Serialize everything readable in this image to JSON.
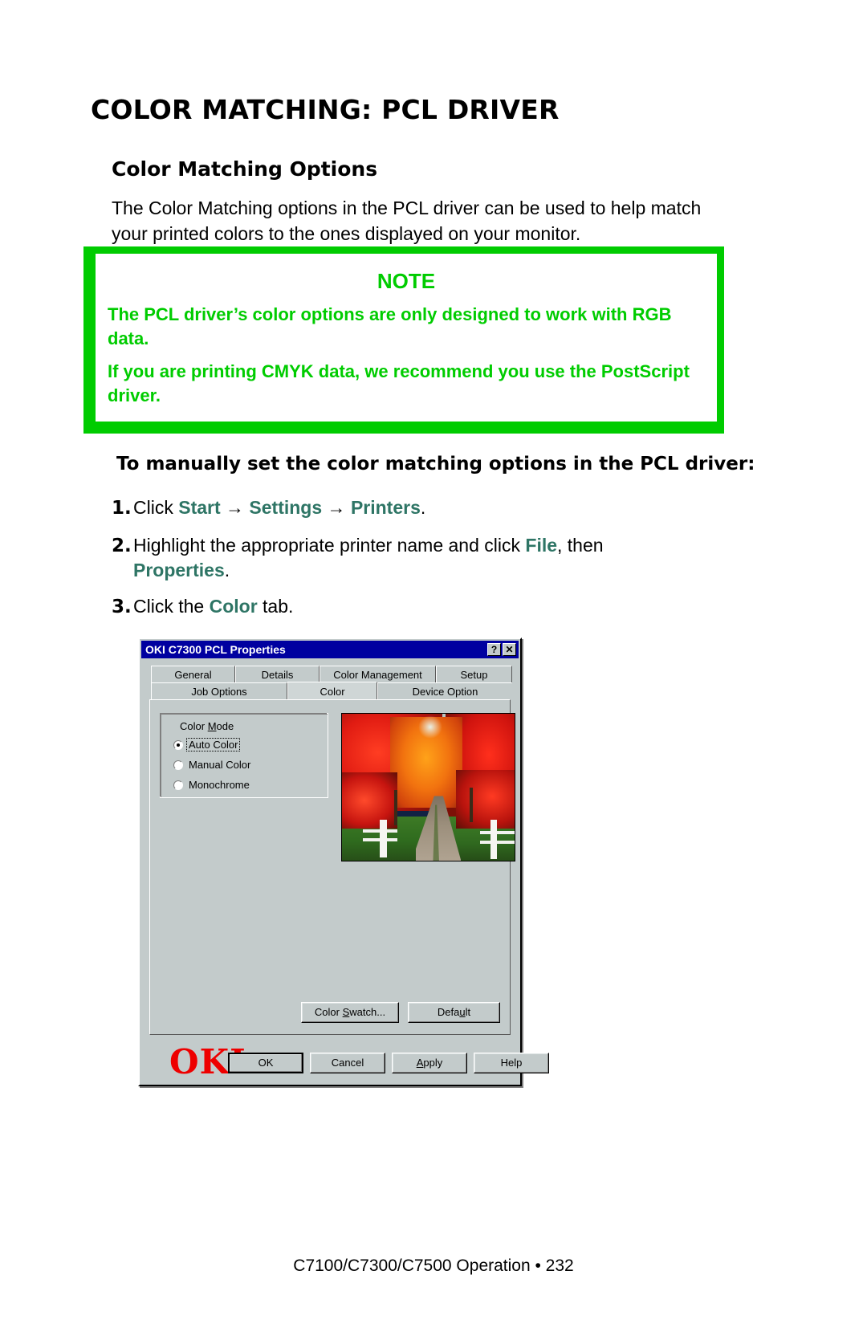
{
  "page": {
    "title": "COLOR MATCHING: PCL DRIVER",
    "section_heading": "Color Matching Options",
    "intro_paragraph": "The Color Matching options in the PCL driver can be used to help match your printed colors to the ones displayed on your monitor.",
    "footer": "C7100/C7300/C7500  Operation • 232"
  },
  "note": {
    "title": "NOTE",
    "paragraph1": "The PCL driver’s color options are only designed to work with RGB data.",
    "paragraph2": "If you are printing CMYK data, we recommend you use the PostScript driver.",
    "accent_color": "#00CC00"
  },
  "procedure": {
    "heading": "To manually set the color matching options in the PCL driver:",
    "emphasis_color": "#2E7565",
    "steps": [
      {
        "number": "1.",
        "parts": [
          {
            "text": "Click ",
            "em": false
          },
          {
            "text": "Start",
            "em": true
          },
          {
            "text": " → ",
            "em": false
          },
          {
            "text": "Settings",
            "em": true
          },
          {
            "text": " → ",
            "em": false
          },
          {
            "text": "Printers",
            "em": true
          },
          {
            "text": ".",
            "em": false
          }
        ]
      },
      {
        "number": "2.",
        "parts": [
          {
            "text": "Highlight the appropriate printer name and click ",
            "em": false
          },
          {
            "text": "File",
            "em": true
          },
          {
            "text": ", then ",
            "em": false
          },
          {
            "text": "Properties",
            "em": true
          },
          {
            "text": ".",
            "em": false
          }
        ]
      },
      {
        "number": "3.",
        "parts": [
          {
            "text": "Click the ",
            "em": false
          },
          {
            "text": "Color",
            "em": true
          },
          {
            "text": " tab.",
            "em": false
          }
        ]
      }
    ]
  },
  "dialog": {
    "title": "OKI C7300 PCL Properties",
    "titlebar_color": "#0000A0",
    "face_color": "#C3CBCB",
    "help_button": "?",
    "close_button": "✕",
    "tabs_row1": [
      {
        "label": "General",
        "active": false
      },
      {
        "label": "Details",
        "active": false
      },
      {
        "label": "Color Management",
        "active": false
      },
      {
        "label": "Setup",
        "active": false
      }
    ],
    "tabs_row2": [
      {
        "label": "Job Options",
        "active": false
      },
      {
        "label": "Color",
        "active": true
      },
      {
        "label": "Device Option",
        "active": false
      }
    ],
    "color_mode": {
      "group_label_pre": "Color ",
      "group_label_key": "M",
      "group_label_post": "ode",
      "options": [
        {
          "label": "Auto Color",
          "selected": true,
          "focused": true
        },
        {
          "label": "Manual Color",
          "selected": false,
          "focused": false
        },
        {
          "label": "Monochrome",
          "selected": false,
          "focused": false
        }
      ]
    },
    "preview": {
      "alt": "autumn-foliage-country-road-photo"
    },
    "logo": "OKI",
    "logo_color": "#EE0000",
    "panel_buttons": [
      {
        "label_pre": "Color ",
        "label_key": "S",
        "label_post": "watch...",
        "default": false
      },
      {
        "label_pre": "Defa",
        "label_key": "u",
        "label_post": "lt",
        "default": false
      }
    ],
    "bottom_buttons": [
      {
        "label_pre": "OK",
        "label_key": "",
        "label_post": "",
        "default": true
      },
      {
        "label_pre": "Cancel",
        "label_key": "",
        "label_post": "",
        "default": false
      },
      {
        "label_pre": "",
        "label_key": "A",
        "label_post": "pply",
        "default": false
      },
      {
        "label_pre": "Help",
        "label_key": "",
        "label_post": "",
        "default": false
      }
    ]
  }
}
